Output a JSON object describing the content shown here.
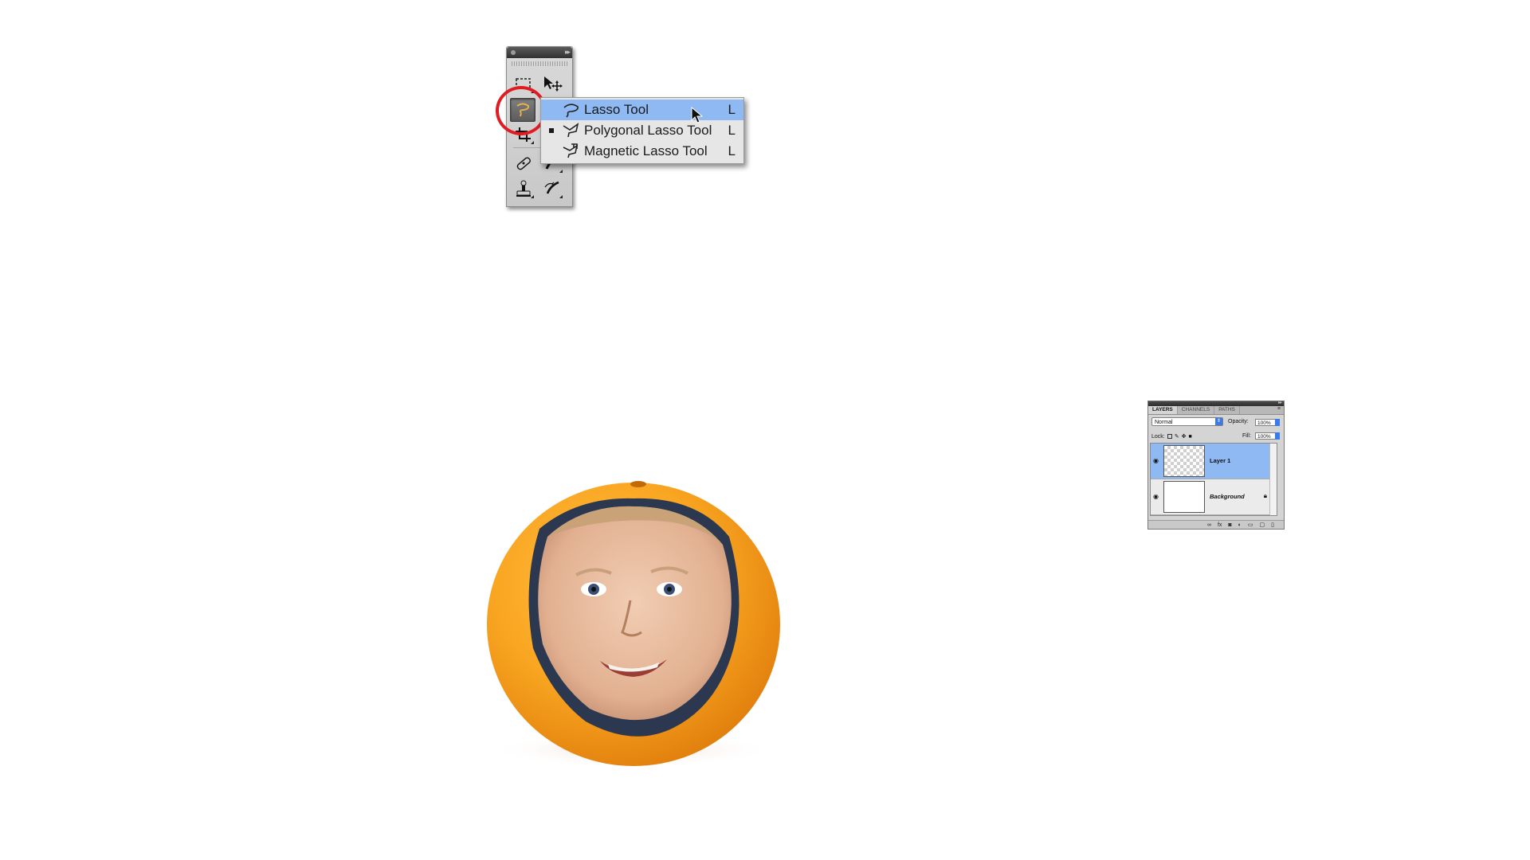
{
  "tools_panel": {
    "collapse_glyph": "▸▸"
  },
  "flyout_menu": {
    "items": [
      {
        "label": "Lasso Tool",
        "shortcut": "L",
        "icon": "lasso-icon",
        "selected": true
      },
      {
        "label": "Polygonal Lasso Tool",
        "shortcut": "L",
        "icon": "polygonal-lasso-icon",
        "selected": false,
        "current": true
      },
      {
        "label": "Magnetic Lasso Tool",
        "shortcut": "L",
        "icon": "magnetic-lasso-icon",
        "selected": false
      }
    ]
  },
  "layers_panel": {
    "tabs": [
      "LAYERS",
      "CHANNELS",
      "PATHS"
    ],
    "blend_mode": "Normal",
    "opacity_label": "Opacity:",
    "opacity_value": "100%",
    "lock_label": "Lock:",
    "fill_label": "Fill:",
    "fill_value": "100%",
    "layers": [
      {
        "name": "Layer 1",
        "selected": true
      },
      {
        "name": "Background",
        "selected": false,
        "locked": true
      }
    ]
  },
  "colors": {
    "highlight": "#8eb9f2",
    "annotation_circle": "#e01b22"
  }
}
